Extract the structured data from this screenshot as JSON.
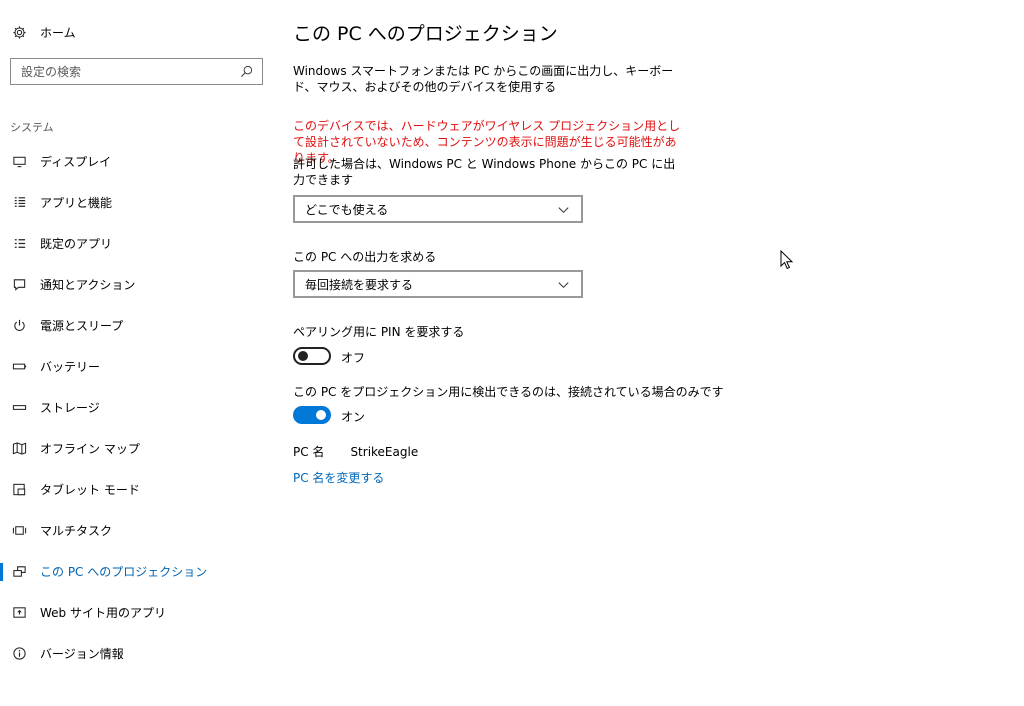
{
  "sidebar": {
    "home_label": "ホーム",
    "search_placeholder": "設定の検索",
    "section_label": "システム",
    "items": [
      {
        "label": "ディスプレイ",
        "icon": "display-icon"
      },
      {
        "label": "アプリと機能",
        "icon": "apps-list-icon"
      },
      {
        "label": "既定のアプリ",
        "icon": "default-apps-icon"
      },
      {
        "label": "通知とアクション",
        "icon": "notification-icon"
      },
      {
        "label": "電源とスリープ",
        "icon": "power-icon"
      },
      {
        "label": "バッテリー",
        "icon": "battery-icon"
      },
      {
        "label": "ストレージ",
        "icon": "storage-icon"
      },
      {
        "label": "オフライン マップ",
        "icon": "map-icon"
      },
      {
        "label": "タブレット モード",
        "icon": "tablet-icon"
      },
      {
        "label": "マルチタスク",
        "icon": "multitask-icon"
      },
      {
        "label": "この PC へのプロジェクション",
        "icon": "projection-icon",
        "active": true
      },
      {
        "label": "Web サイト用のアプリ",
        "icon": "web-apps-icon"
      },
      {
        "label": "バージョン情報",
        "icon": "info-icon"
      }
    ]
  },
  "main": {
    "title": "この PC へのプロジェクション",
    "description": "Windows スマートフォンまたは PC からこの画面に出力し、キーボード、マウス、およびその他のデバイスを使用する",
    "warning": "このデバイスでは、ハードウェアがワイヤレス プロジェクション用として設計されていないため、コンテンツの表示に問題が生じる可能性があります。",
    "permission_label": "許可した場合は、Windows PC と Windows Phone からこの PC に出力できます",
    "permission_value": "どこでも使える",
    "ask_label": "この PC への出力を求める",
    "ask_value": "毎回接続を要求する",
    "pin_label": "ペアリング用に PIN を要求する",
    "pin_state": "オフ",
    "detect_label": "この PC をプロジェクション用に検出できるのは、接続されている場合のみです",
    "detect_state": "オン",
    "pc_name_label": "PC 名",
    "pc_name_value": "StrikeEagle",
    "rename_link": "PC 名を変更する"
  },
  "colors": {
    "accent": "#0078d7",
    "warning": "#e01010",
    "link": "#0067b8"
  }
}
